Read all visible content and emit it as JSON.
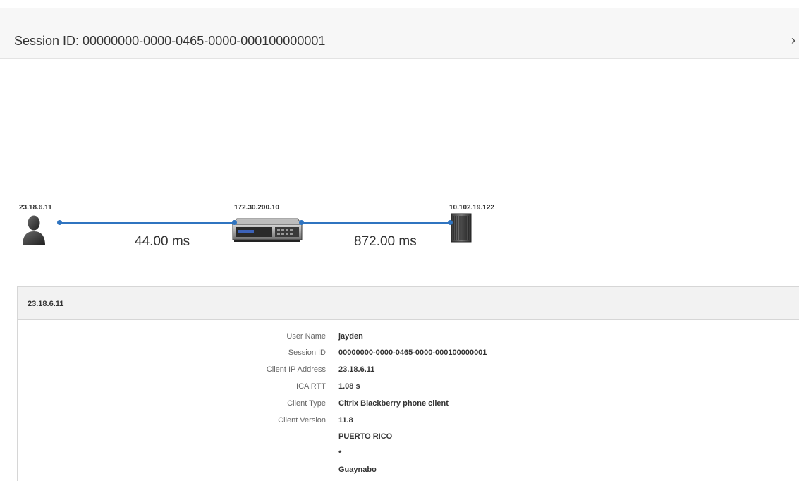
{
  "header": {
    "title": "Session ID: 00000000-0000-0465-0000-000100000001",
    "close_glyph": "›"
  },
  "topology": {
    "nodes": [
      {
        "label": "23.18.6.11",
        "icon": "user-icon"
      },
      {
        "label": "172.30.200.10",
        "icon": "appliance-icon"
      },
      {
        "label": "10.102.19.122",
        "icon": "server-icon"
      }
    ],
    "links": [
      {
        "latency": "44.00 ms"
      },
      {
        "latency": "872.00 ms"
      }
    ],
    "link_color": "#2f74c0"
  },
  "details": {
    "title": "23.18.6.11",
    "rows": [
      {
        "key": "User Name",
        "value": "jayden"
      },
      {
        "key": "Session ID",
        "value": "00000000-0000-0465-0000-000100000001"
      },
      {
        "key": "Client IP Address",
        "value": "23.18.6.11"
      },
      {
        "key": "ICA RTT",
        "value": "1.08 s"
      },
      {
        "key": "Client Type",
        "value": "Citrix Blackberry phone client"
      },
      {
        "key": "Client Version",
        "value": "11.8"
      },
      {
        "key": "",
        "value": "PUERTO RICO"
      },
      {
        "key": "",
        "value": "*"
      },
      {
        "key": "",
        "value": "Guaynabo"
      }
    ]
  }
}
